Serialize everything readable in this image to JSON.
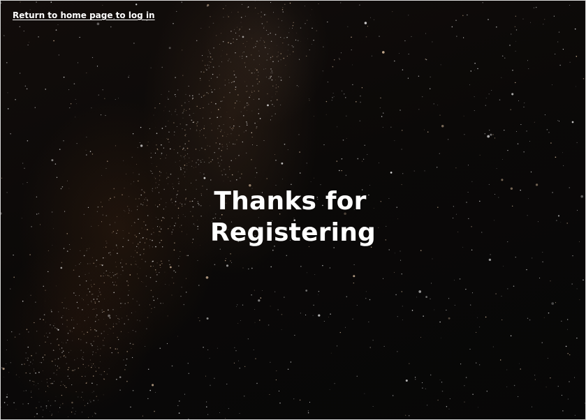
{
  "header": {
    "home_link_label": "Return to home page to log in"
  },
  "main": {
    "heading_line1": "Thanks for",
    "heading_line2": "Registering"
  },
  "colors": {
    "background": "#0a0808",
    "text": "#ffffff",
    "nebula": "#6e3c19"
  }
}
